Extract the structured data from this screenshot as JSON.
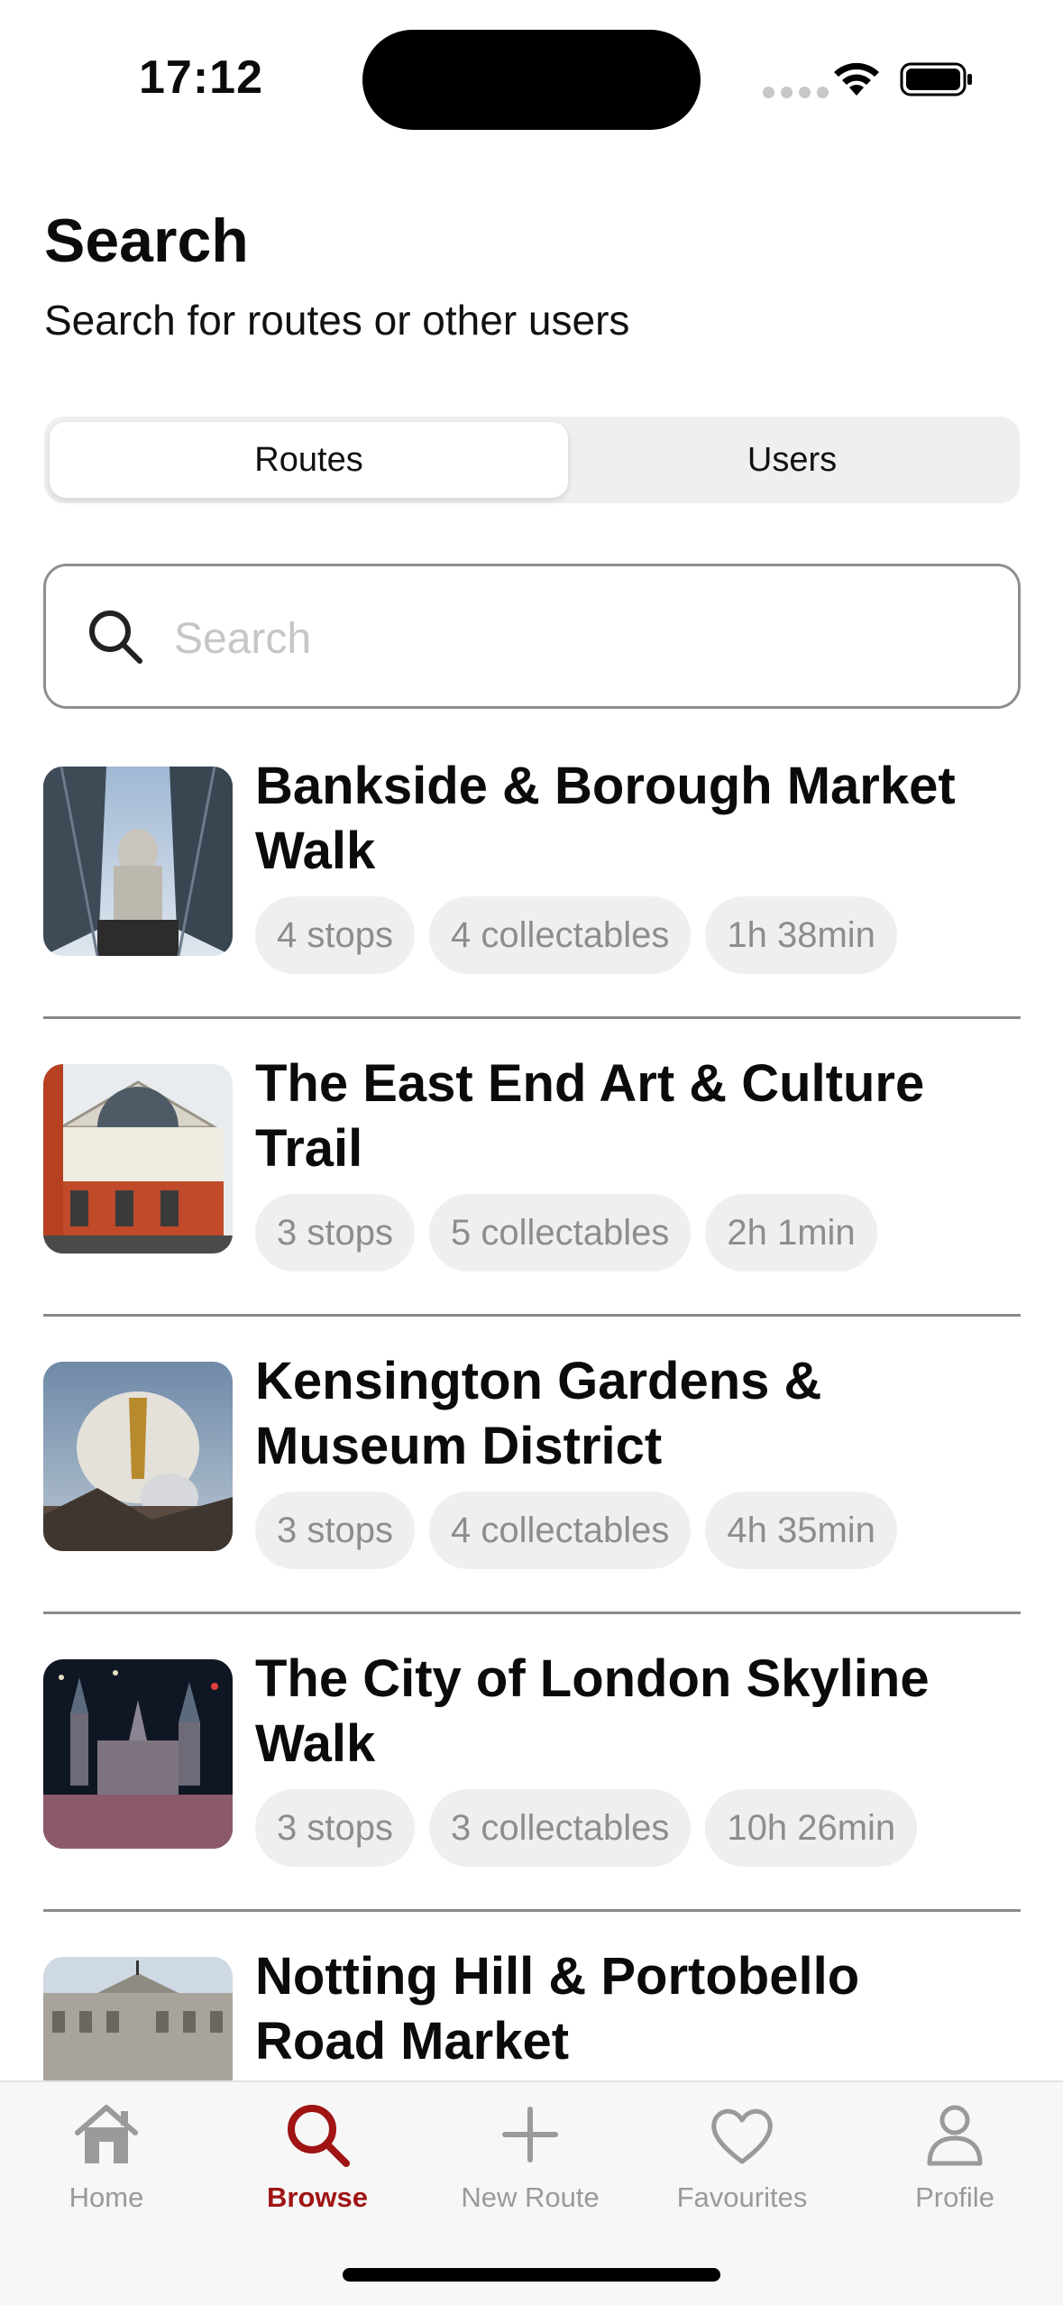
{
  "status_bar": {
    "time": "17:12"
  },
  "header": {
    "title": "Search",
    "subtitle": "Search for routes or other users"
  },
  "segmented": {
    "options": [
      "Routes",
      "Users"
    ],
    "selected": "Routes"
  },
  "search": {
    "placeholder": "Search",
    "value": ""
  },
  "routes": [
    {
      "title": "Bankside & Borough Market Walk",
      "stops": "4 stops",
      "collectables": "4 collectables",
      "duration": "1h 38min"
    },
    {
      "title": "The East End Art & Culture Trail",
      "stops": "3 stops",
      "collectables": "5 collectables",
      "duration": "2h 1min"
    },
    {
      "title": "Kensington Gardens & Museum District",
      "stops": "3 stops",
      "collectables": "4 collectables",
      "duration": "4h 35min"
    },
    {
      "title": "The City of London Skyline Walk",
      "stops": "3 stops",
      "collectables": "3 collectables",
      "duration": "10h 26min"
    },
    {
      "title": "Notting Hill & Portobello Road Market",
      "stops": "",
      "collectables": "",
      "duration": ""
    }
  ],
  "tab_bar": {
    "items": [
      {
        "label": "Home",
        "icon": "house-icon"
      },
      {
        "label": "Browse",
        "icon": "search-icon"
      },
      {
        "label": "New Route",
        "icon": "plus-icon"
      },
      {
        "label": "Favourites",
        "icon": "heart-icon"
      },
      {
        "label": "Profile",
        "icon": "person-icon"
      }
    ],
    "active": "Browse"
  },
  "colors": {
    "accent": "#a01414",
    "chip_bg": "#efefef",
    "chip_text": "#8d8d8d",
    "inactive_tab": "#9a9a9a"
  }
}
